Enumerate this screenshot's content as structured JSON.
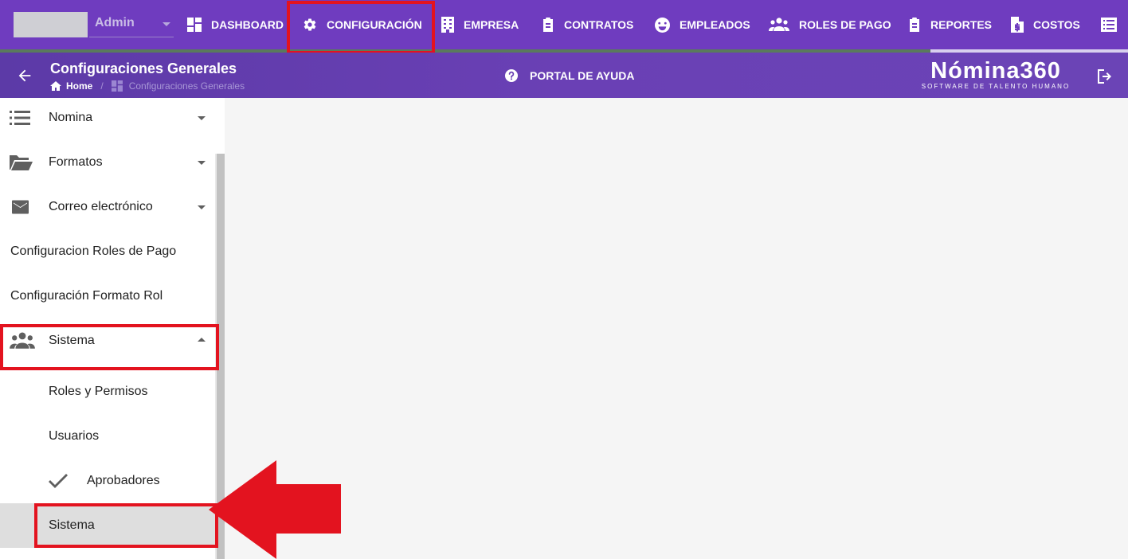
{
  "topbar": {
    "user_select": "Admin",
    "nav": [
      {
        "label": "DASHBOARD",
        "icon": "dashboard-icon"
      },
      {
        "label": "CONFIGURACIÓN",
        "icon": "gear-icon"
      },
      {
        "label": "EMPRESA",
        "icon": "building-icon"
      },
      {
        "label": "CONTRATOS",
        "icon": "clipboard-icon"
      },
      {
        "label": "EMPLEADOS",
        "icon": "face-icon"
      },
      {
        "label": "ROLES DE PAGO",
        "icon": "people-icon"
      },
      {
        "label": "REPORTES",
        "icon": "report-icon"
      },
      {
        "label": "COSTOS",
        "icon": "invoice-icon"
      }
    ]
  },
  "subheader": {
    "title": "Configuraciones Generales",
    "breadcrumb_home": "Home",
    "breadcrumb_sep": "/",
    "breadcrumb_current": "Configuraciones Generales",
    "help": "PORTAL DE AYUDA",
    "logo_main": "Nómina360",
    "logo_sub": "SOFTWARE DE TALENTO HUMANO"
  },
  "sidebar": {
    "items": [
      {
        "label": "Nomina",
        "icon": "list-icon",
        "expandable": true
      },
      {
        "label": "Formatos",
        "icon": "folder-open-icon",
        "expandable": true
      },
      {
        "label": "Correo electrónico",
        "icon": "mail-icon",
        "expandable": true
      },
      {
        "label": "Configuracion Roles de Pago"
      },
      {
        "label": "Configuración Formato Rol"
      },
      {
        "label": "Sistema",
        "icon": "people-icon",
        "expandable": true,
        "expanded": true
      },
      {
        "label": "Roles y Permisos"
      },
      {
        "label": "Usuarios"
      },
      {
        "label": "Aprobadores",
        "icon": "check-icon"
      },
      {
        "label": "Sistema",
        "active": true
      }
    ]
  },
  "colors": {
    "brand": "#6f3cbf",
    "highlight": "#e3131f"
  }
}
